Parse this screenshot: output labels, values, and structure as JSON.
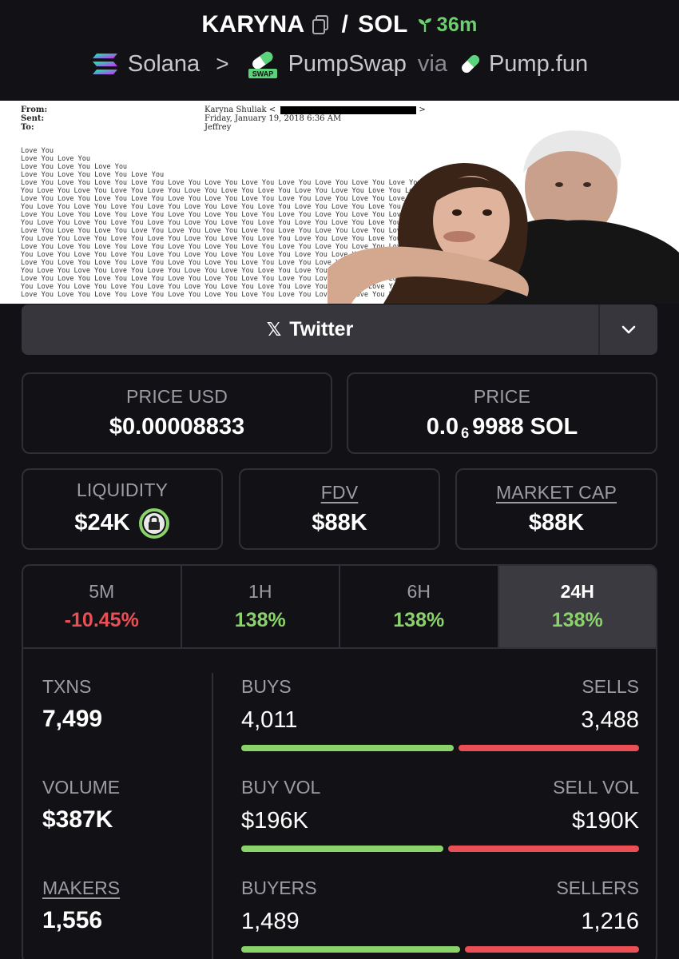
{
  "header": {
    "token_symbol": "KARYNA",
    "separator": "/",
    "quote_symbol": "SOL",
    "age": "36m",
    "chain": "Solana",
    "dex": "PumpSwap",
    "dex_badge": "SWAP",
    "via_label": "via",
    "launchpad": "Pump.fun"
  },
  "banner": {
    "from_label": "From:",
    "sent_label": "Sent:",
    "to_label": "To:",
    "from_value": "Karyna Shuliak <",
    "sent_value": "Friday, January 19, 2018 6:36 AM",
    "to_value": "Jeffrey",
    "love_lines": [
      "Love You",
      "Love You Love You",
      "Love You Love You Love You",
      "Love You Love You Love You Love You",
      "Love You Love You Love You Love You Love You Love You Love You Love You Love You Love You Love You",
      "You Love You Love You Love You Love You Love You Love You Love You Love You Love You Love You Love",
      "Love You Love You Love You Love You Love You Love You Love You Love You Love You Love You Love You",
      "You Love You Love You Love You Love You Love You Love You Love You Love You Love You Love You Love",
      "Love You Love You Love You Love You Love You Love You Love You Love You Love You Love You Love You",
      "You Love You Love You Love You Love You Love You Love You Love You Love You Love You Love You Love",
      "Love You Love You Love You Love You Love You Love You Love You Love You Love You Love You Love You",
      "You Love You Love You Love You Love You Love You Love You Love You Love You Love You Love You Love",
      "Love You Love You Love You Love You Love You Love You Love You Love You Love You Love You Love You",
      "You Love You Love You Love You Love You Love You Love You Love You Love You Love You Love You Love",
      "Love You Love You Love You Love You Love You Love You Love You Love You Love You Love You Love You",
      "You Love You Love You Love You Love You Love You Love You Love You Love You Love You Love You Love",
      "Love You Love You Love You Love You Love You Love You Love You Love You Love You Love You Love You",
      "You Love You Love You Love You Love You Love You Love You Love You Love You Love You Love You Love",
      "Love You Love You Love You Love You Love You Love You Love You Love You Love You Love You Love You"
    ]
  },
  "social": {
    "twitter_label": "Twitter",
    "x_glyph": "𝕏"
  },
  "price": {
    "usd_label": "PRICE USD",
    "usd_value": "$0.00008833",
    "sol_label": "PRICE",
    "sol_prefix": "0.0",
    "sol_subscript": "6",
    "sol_suffix": "9988 SOL"
  },
  "market": {
    "liquidity_label": "LIQUIDITY",
    "liquidity_value": "$24K",
    "fdv_label": "FDV",
    "fdv_value": "$88K",
    "mcap_label": "MARKET CAP",
    "mcap_value": "$88K"
  },
  "tabs": [
    {
      "label": "5M",
      "value": "-10.45%",
      "color": "#ea4f55",
      "active": false
    },
    {
      "label": "1H",
      "value": "138%",
      "color": "#8ad36a",
      "active": false
    },
    {
      "label": "6H",
      "value": "138%",
      "color": "#8ad36a",
      "active": false
    },
    {
      "label": "24H",
      "value": "138%",
      "color": "#8ad36a",
      "active": true
    }
  ],
  "stats": {
    "txns_label": "TXNS",
    "txns_value": "7,499",
    "volume_label": "VOLUME",
    "volume_value": "$387K",
    "makers_label": "MAKERS",
    "makers_value": "1,556",
    "buys_label": "BUYS",
    "buys_value": "4,011",
    "sells_label": "SELLS",
    "sells_value": "3,488",
    "buys_fraction": 0.535,
    "buy_vol_label": "BUY VOL",
    "buy_vol_value": "$196K",
    "sell_vol_label": "SELL VOL",
    "sell_vol_value": "$190K",
    "buy_vol_fraction": 0.508,
    "buyers_label": "BUYERS",
    "buyers_value": "1,489",
    "sellers_label": "SELLERS",
    "sellers_value": "1,216",
    "buyers_fraction": 0.55
  },
  "colors": {
    "background": "#121216",
    "green": "#8ad36a",
    "red": "#ea4f55",
    "muted": "#9c9ca3"
  }
}
